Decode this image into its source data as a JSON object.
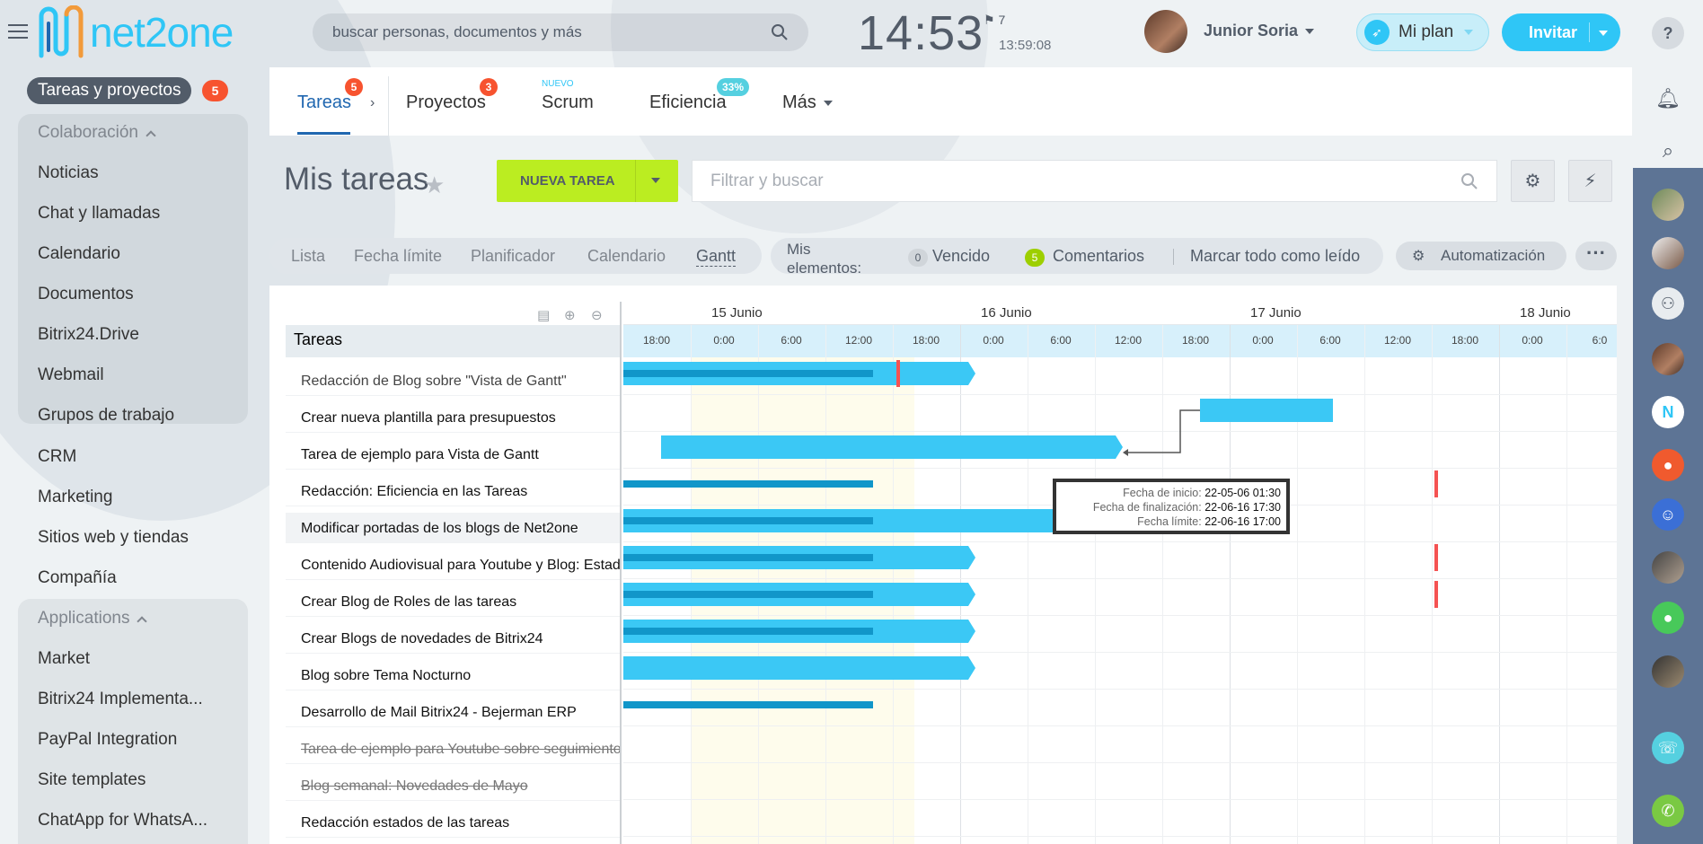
{
  "brand": {
    "name": "net2one"
  },
  "search": {
    "placeholder": "buscar personas, documentos y más"
  },
  "clock": {
    "time": "14:53",
    "flag": "7",
    "sub": "13:59:08"
  },
  "user": {
    "name": "Junior Soria"
  },
  "plan": {
    "label": "Mi plan"
  },
  "invite": {
    "label": "Invitar"
  },
  "sidebar": {
    "header": "Tareas y proyectos",
    "header_badge": "5",
    "sections": [
      {
        "label": "Colaboración"
      },
      {
        "label": "Applications"
      }
    ],
    "items": [
      "Noticias",
      "Chat y llamadas",
      "Calendario",
      "Documentos",
      "Bitrix24.Drive",
      "Webmail",
      "Grupos de trabajo",
      "CRM",
      "Marketing",
      "Sitios web y tiendas",
      "Compañía",
      "Market",
      "Bitrix24 Implementa...",
      "PayPal Integration",
      "Site templates",
      "ChatApp for WhatsA..."
    ]
  },
  "tabs": [
    {
      "label": "Tareas",
      "badge": "5"
    },
    {
      "label": "Proyectos",
      "badge": "3"
    },
    {
      "label": "Scrum",
      "tag": "NUEVO"
    },
    {
      "label": "Eficiencia",
      "badge": "33%"
    },
    {
      "label": "Más"
    }
  ],
  "page": {
    "title": "Mis tareas",
    "new_task": "NUEVA TAREA",
    "filter_placeholder": "Filtrar y buscar"
  },
  "views": [
    "Lista",
    "Fecha límite",
    "Planificador",
    "Calendario",
    "Gantt"
  ],
  "elements": {
    "label": "Mis elementos:",
    "overdue_count": "0",
    "overdue": "Vencido",
    "comments_count": "5",
    "comments": "Comentarios",
    "mark_read": "Marcar todo como leído"
  },
  "automation": {
    "label": "Automatización"
  },
  "gantt": {
    "column_title": "Tareas",
    "days": [
      "15 Junio",
      "16 Junio",
      "17 Junio",
      "18 Junio"
    ],
    "hours": [
      "18:00",
      "0:00",
      "6:00",
      "12:00",
      "18:00",
      "0:00",
      "6:00",
      "12:00",
      "18:00",
      "0:00",
      "6:00",
      "12:00",
      "18:00",
      "0:00",
      "6:0"
    ],
    "tasks": [
      {
        "name": "Redacción de Blog sobre \"Vista de Gantt\""
      },
      {
        "name": "Crear nueva plantilla para presupuestos"
      },
      {
        "name": "Tarea de ejemplo para Vista de Gantt"
      },
      {
        "name": "Redacción: Eficiencia en las Tareas"
      },
      {
        "name": "Modificar portadas de los blogs de Net2one"
      },
      {
        "name": "Contenido Audiovisual para Youtube y Blog: Estado"
      },
      {
        "name": "Crear Blog de Roles de las tareas"
      },
      {
        "name": "Crear Blogs de novedades de Bitrix24"
      },
      {
        "name": "Blog sobre Tema Nocturno"
      },
      {
        "name": "Desarrollo de Mail Bitrix24 - Bejerman ERP"
      },
      {
        "name": "Tarea de ejemplo para Youtube sobre seguimiento"
      },
      {
        "name": "Blog semanal: Novedades de Mayo"
      },
      {
        "name": "Redacción estados de las tareas"
      }
    ],
    "tooltip": {
      "start_label": "Fecha de inicio:",
      "start_value": "22-05-06 01:30",
      "end_label": "Fecha de finalización:",
      "end_value": "22-06-16 17:30",
      "deadline_label": "Fecha límite:",
      "deadline_value": "22-06-16 17:00"
    }
  },
  "colors": {
    "accent": "#2fc6f6",
    "active_tab": "#2067b0",
    "badge": "#f7532f",
    "new_task": "#bbed21",
    "bar": "#3bc8f5",
    "progress": "#1196c9",
    "deadline": "#f55252"
  }
}
